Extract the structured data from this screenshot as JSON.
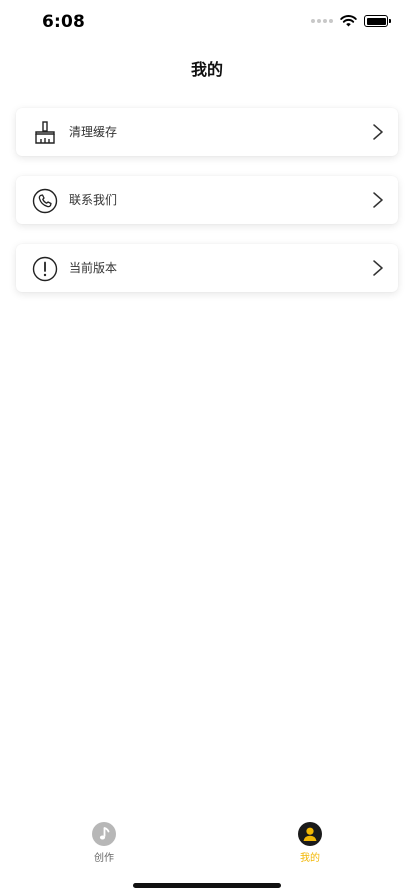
{
  "status_bar": {
    "time": "6:08"
  },
  "nav": {
    "title": "我的"
  },
  "menu": {
    "items": [
      {
        "label": "清理缓存",
        "icon": "broom-icon"
      },
      {
        "label": "联系我们",
        "icon": "phone-icon"
      },
      {
        "label": "当前版本",
        "icon": "info-exclamation-icon"
      }
    ]
  },
  "tabbar": {
    "tabs": [
      {
        "label": "创作",
        "icon": "music-note-icon",
        "active": false
      },
      {
        "label": "我的",
        "icon": "user-icon",
        "active": true
      }
    ]
  },
  "colors": {
    "accent": "#f2b705",
    "inactive_tab": "#b7b7b7",
    "text": "#333333",
    "background": "#ffffff"
  }
}
